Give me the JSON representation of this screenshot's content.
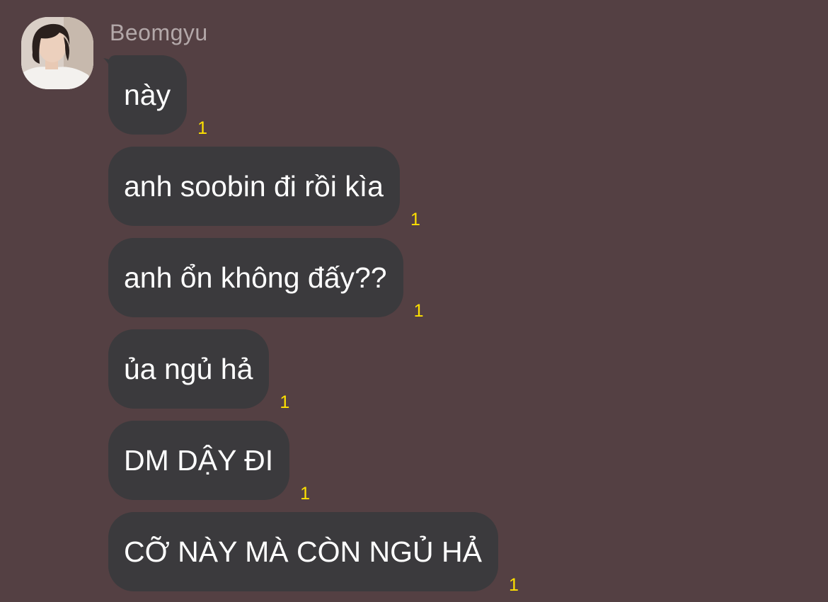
{
  "sender": {
    "name": "Beomgyu",
    "avatar_icon": "profile-photo"
  },
  "messages": [
    {
      "text": "này",
      "unread": "1"
    },
    {
      "text": "anh soobin đi rồi kìa",
      "unread": "1"
    },
    {
      "text": "anh ổn không đấy??",
      "unread": "1"
    },
    {
      "text": "ủa ngủ hả",
      "unread": "1"
    },
    {
      "text": "DM DẬY ĐI",
      "unread": "1"
    },
    {
      "text": "CỠ NÀY MÀ CÒN NGỦ HẢ",
      "unread": "1"
    }
  ],
  "colors": {
    "background": "#544043",
    "bubble": "#3b3a3d",
    "unread_count": "#ffe100",
    "sender_name": "#b3a8a9"
  }
}
